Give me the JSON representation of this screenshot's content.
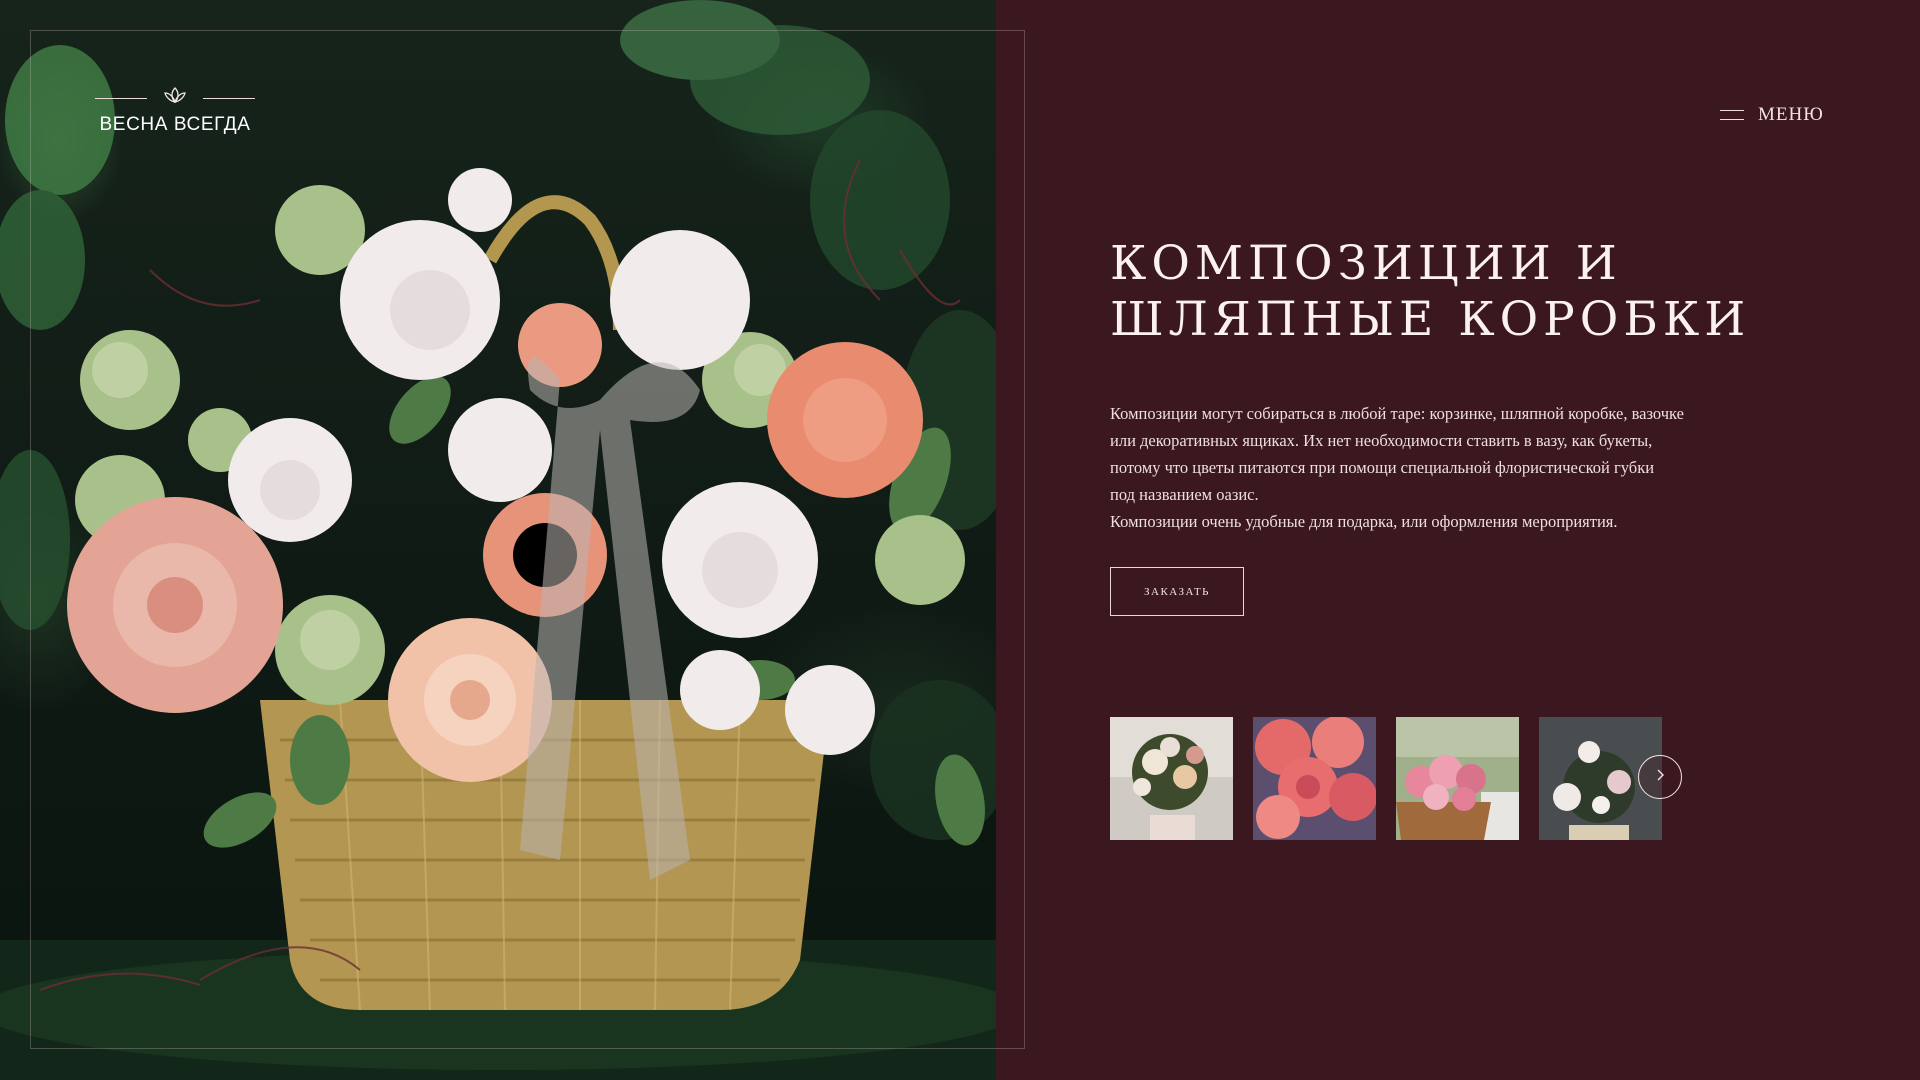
{
  "brand": {
    "name": "ВЕСНА ВСЕГДА",
    "logo_icon": "lotus-icon"
  },
  "header": {
    "menu_label": "МЕНЮ",
    "menu_icon": "hamburger-icon"
  },
  "hero": {
    "title_line1": "КОМПОЗИЦИИ И",
    "title_line2": "ШЛЯПНЫЕ КОРОБКИ",
    "description": [
      "Композиции могут собираться в любой таре: корзинке, шляпной коробке, вазочке",
      "или декоративных ящиках. Их нет необходимости ставить в вазу, как букеты,",
      "потому что цветы питаются при помощи специальной флористической губки",
      "под названием оазис.",
      "Композиции очень удобные для подарка, или оформления мероприятия."
    ],
    "order_label": "ЗАКАЗАТЬ"
  },
  "gallery": {
    "thumbnails": [
      "bouquet-in-vase",
      "pink-roses",
      "roses-in-basket",
      "white-flowers-box"
    ],
    "next_icon": "chevron-right-icon"
  },
  "colors": {
    "background": "#3b181f",
    "text": "#f3e6e4"
  }
}
